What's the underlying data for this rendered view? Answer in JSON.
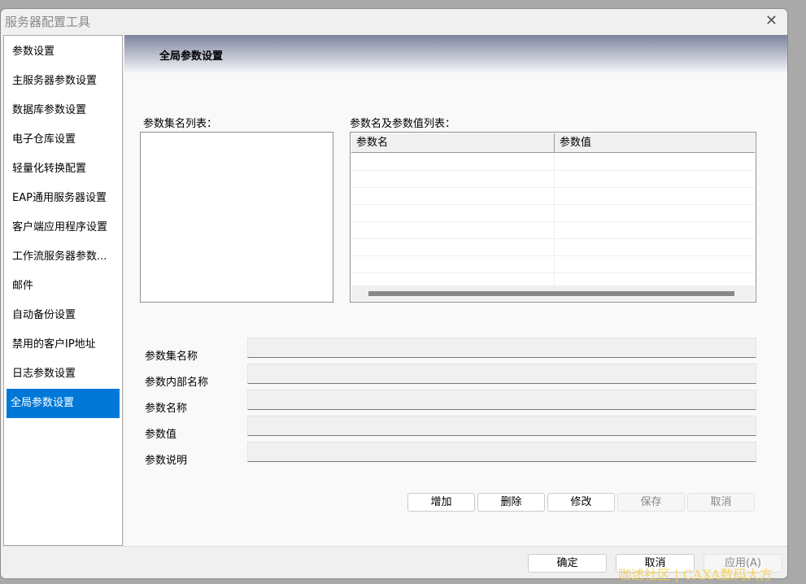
{
  "window": {
    "title": "服务器配置工具"
  },
  "sidebar": {
    "items": [
      {
        "label": "参数设置"
      },
      {
        "label": "主服务器参数设置"
      },
      {
        "label": "数据库参数设置"
      },
      {
        "label": "电子仓库设置"
      },
      {
        "label": "轻量化转换配置"
      },
      {
        "label": "EAP通用服务器设置"
      },
      {
        "label": "客户端应用程序设置"
      },
      {
        "label": "工作流服务器参数..."
      },
      {
        "label": "邮件"
      },
      {
        "label": "自动备份设置"
      },
      {
        "label": "禁用的客户IP地址"
      },
      {
        "label": "日志参数设置"
      },
      {
        "label": "全局参数设置"
      }
    ],
    "selected": 12
  },
  "main": {
    "heading": "全局参数设置",
    "set_list_label": "参数集名列表：",
    "grid_label": "参数名及参数值列表：",
    "grid_columns": [
      "参数名",
      "参数值"
    ],
    "fields": [
      {
        "label": "参数集名称",
        "value": ""
      },
      {
        "label": "参数内部名称",
        "value": ""
      },
      {
        "label": "参数名称",
        "value": ""
      },
      {
        "label": "参数值",
        "value": ""
      },
      {
        "label": "参数说明",
        "value": ""
      }
    ],
    "buttons": {
      "add": "增加",
      "delete": "删除",
      "modify": "修改",
      "save": "保存",
      "cancel": "取消"
    }
  },
  "footer": {
    "ok": "确定",
    "cancel": "取消",
    "apply": "应用(A)"
  },
  "watermark": "咖述社区 | CAXA数码大方"
}
